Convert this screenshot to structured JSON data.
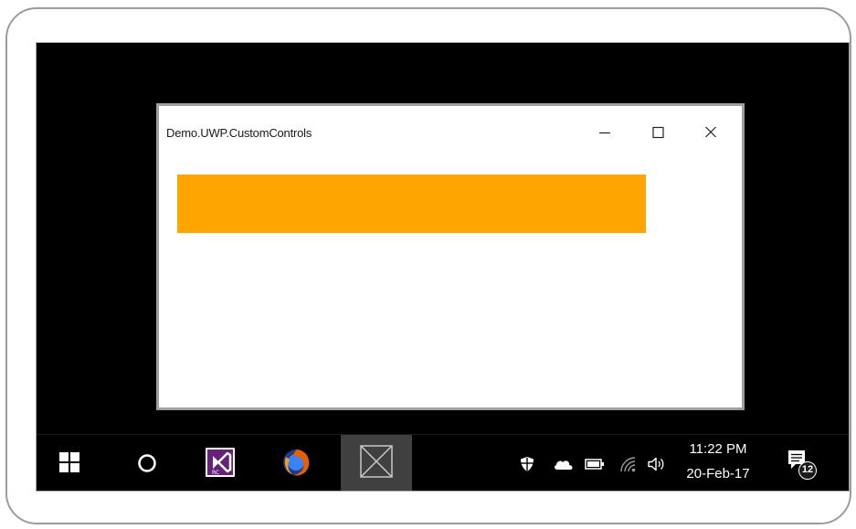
{
  "window": {
    "title": "Demo.UWP.CustomControls",
    "buttons": {
      "minimize_icon": "minimize-icon",
      "maximize_icon": "maximize-icon",
      "close_icon": "close-icon"
    }
  },
  "custom_control": {
    "color": "#FFA500"
  },
  "taskbar": {
    "apps": [
      {
        "name": "start",
        "icon": "windows-logo-icon"
      },
      {
        "name": "search",
        "icon": "cortana-ring-icon"
      },
      {
        "name": "visual-studio",
        "icon": "visual-studio-icon",
        "running": true
      },
      {
        "name": "firefox",
        "icon": "firefox-icon",
        "running": true
      },
      {
        "name": "demo-app",
        "icon": "app-placeholder-icon",
        "running": true,
        "active": true
      }
    ],
    "tray_icons": [
      "shield-icon",
      "cloud-icon",
      "battery-icon",
      "wifi-icon",
      "volume-icon"
    ],
    "clock": {
      "time": "11:22 PM",
      "date": "20-Feb-17"
    },
    "notifications": {
      "count": "12"
    }
  },
  "colors": {
    "accent_indicator": "#5DB2EA",
    "taskbar_bg": "#000000",
    "active_app_bg": "#404040",
    "visual_studio": "#68217A",
    "firefox_orange": "#E66000"
  }
}
